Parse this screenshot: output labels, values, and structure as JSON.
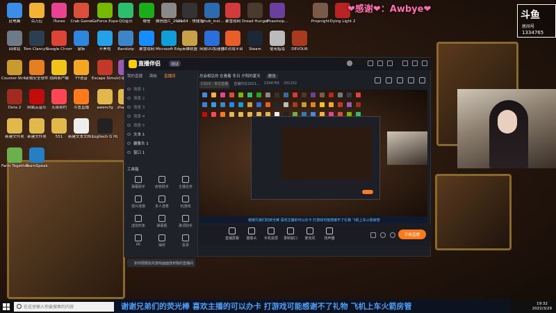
{
  "overlay": {
    "banner_top": "❤感谢❤：Awbye❤",
    "douyu": {
      "logo": "斗鱼",
      "label": "房间号",
      "room": "1334765"
    },
    "bottom_banner": "谢谢兄弟们的荧光棒 喜欢主播的可以办卡 打游戏可能感谢不了礼物 飞机上车火箭房管"
  },
  "desktop": {
    "icons": [
      {
        "label": "此电脑",
        "color": "#3b8ee8"
      },
      {
        "label": "百万应",
        "color": "#f2b233"
      },
      {
        "label": "iTunes",
        "color": "#e84393"
      },
      {
        "label": "Crab Game",
        "color": "#d94f3a"
      },
      {
        "label": "GeForce Experience",
        "color": "#76b900"
      },
      {
        "label": "QQ音乐",
        "color": "#2dbd6e"
      },
      {
        "label": "微信",
        "color": "#1aad19"
      },
      {
        "label": "微信图片_2021111...",
        "color": "#8a8a8a"
      },
      {
        "label": "obs64 - 快捷方式",
        "color": "#333333"
      },
      {
        "label": "lghub_inst...",
        "color": "#2b6cb0"
      },
      {
        "label": "暴雪战网",
        "color": "#d23b3b"
      },
      {
        "label": "Dread Hunger",
        "color": "#4a3a2e"
      },
      {
        "label": "Phasmop...",
        "color": "#6b3fa0"
      },
      {
        "label": "Propnight",
        "color": "#7a5a48"
      },
      {
        "label": "Dying Light 2",
        "color": "#b82323"
      },
      {
        "label": "回收站",
        "color": "#6d7b88"
      },
      {
        "label": "Tom Clancy's Rainbow Six Siege",
        "color": "#2c3e50"
      },
      {
        "label": "Google Chrome",
        "color": "#db4437"
      },
      {
        "label": "鼠标",
        "color": "#2e86de"
      },
      {
        "label": "开黑啦",
        "color": "#24a1e8"
      },
      {
        "label": "Bandizip",
        "color": "#3a86c8"
      },
      {
        "label": "暴雪战网",
        "color": "#148eff"
      },
      {
        "label": "Microsoft Edge",
        "color": "#0f9fd8"
      },
      {
        "label": "英雄联盟",
        "color": "#c7a04a"
      },
      {
        "label": "网易UU加速器",
        "color": "#2a6fdb"
      },
      {
        "label": "5E对战平台",
        "color": "#e85d2a"
      },
      {
        "label": "Steam",
        "color": "#1b2838"
      },
      {
        "label": "使用指南",
        "color": "#bbbbbb"
      },
      {
        "label": "DEVOUR",
        "color": "#a83a1e"
      },
      {
        "label": "Counter-Strike: Global Off...",
        "color": "#c99a2e"
      },
      {
        "label": "火绒安全软件",
        "color": "#e67e22"
      },
      {
        "label": "战网客户端",
        "color": "#f0c419"
      },
      {
        "label": "YY语音",
        "color": "#f5a623"
      },
      {
        "label": "Escape Simulator",
        "color": "#c0392b"
      },
      {
        "label": "小助元动",
        "color": "#9b59b6"
      },
      {
        "label": "Dota 2",
        "color": "#a02b1f"
      },
      {
        "label": "网易云音乐",
        "color": "#c20c0c"
      },
      {
        "label": "无畏契约",
        "color": "#ff4655"
      },
      {
        "label": "斗鱼直播",
        "color": "#ff7a1a"
      },
      {
        "label": "awencfg",
        "color": "#e0b84c"
      },
      {
        "label": "zhaopian",
        "color": "#e0b84c"
      },
      {
        "label": "新建文件夹",
        "color": "#e0b84c"
      },
      {
        "label": "新建文件夹",
        "color": "#e0b84c"
      },
      {
        "label": "551",
        "color": "#e0b84c"
      },
      {
        "label": "新建文本文档 (3)",
        "color": "#eeeeee"
      },
      {
        "label": "Logitech G HUB",
        "color": "#222222"
      },
      {
        "label": "Farm Together",
        "color": "#6ab04c"
      },
      {
        "label": "TeamSpeak",
        "color": "#2580c3"
      }
    ]
  },
  "app": {
    "brand": "直播伴侣",
    "beta": "测试",
    "left_tabs": [
      "我的直播",
      "面板",
      "直播间"
    ],
    "scenes": [
      "场景 1",
      "场景 2",
      "场景 3",
      "场景 4",
      "场景 5",
      "文本 1",
      "摄像头 1",
      "窗口 1"
    ],
    "tools_title": "工具箱",
    "tools": [
      "弹幕助手",
      "房管助手",
      "主播任务",
      "观众连接",
      "多人连麦",
      "玩游戏",
      "虚拟形象",
      "弹幕姬",
      "歌词助手",
      "PK",
      "抽奖",
      "投票"
    ],
    "notice": "如何把朋友的游戏画面放到我的直播间",
    "preview_title": "总会相见的 在看着 冬日 夕阳的夏天",
    "preview_tag": "更改",
    "sub_items": [
      "CSGO · 单位直播",
      "直播时长2021...",
      "1334765",
      "201152"
    ],
    "ticker": "谢谢兄弟们的荧光棒 喜欢主播的可以办卡 打游戏可能感谢不了礼物 飞机上车火箭房管",
    "bottom_tools": [
      "直播屏幕",
      "摄像头",
      "手机投屏",
      "录制窗口",
      "麦克风",
      "扬声器"
    ],
    "live_button": "开始直播"
  },
  "taskbar": {
    "search_placeholder": "在这里输入你要搜索的内容",
    "time": "19:32",
    "date": "2022/3/29"
  }
}
